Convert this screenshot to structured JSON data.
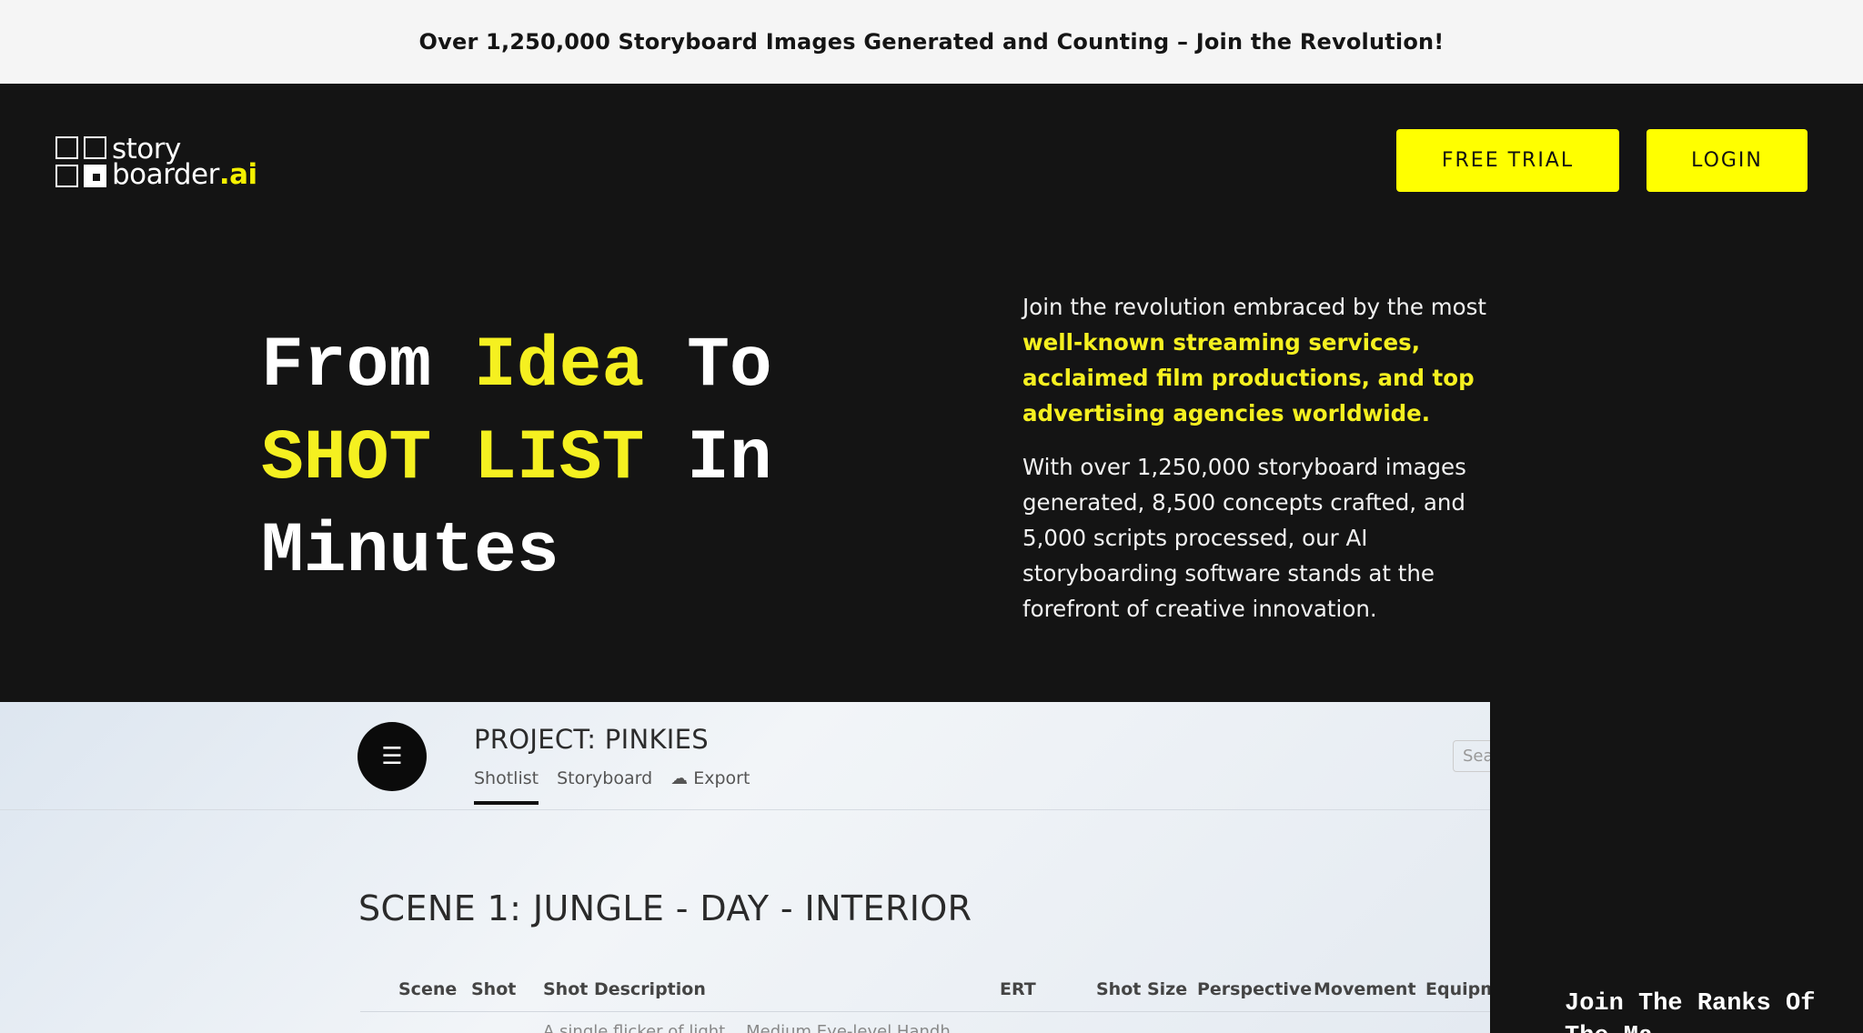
{
  "announcement": "Over 1,250,000 Storyboard Images Generated and Counting – Join the Revolution!",
  "logo": {
    "line1": "story",
    "line2_prefix": "boarder",
    "line2_suffix": ".ai"
  },
  "nav": {
    "free_trial": "FREE TRIAL",
    "login": "LOGIN"
  },
  "hero": {
    "title_1": "From ",
    "title_2": "Idea",
    "title_3": " To",
    "title_4": "SHOT LIST",
    "title_5": " In",
    "title_6": "Minutes",
    "copy_1_plain": "Join the revolution embraced by the most ",
    "copy_1_highlight": "well-known streaming services, acclaimed film productions, and top advertising agencies worldwide.",
    "copy_2": "With over 1,250,000 storyboard images generated, 8,500 concepts crafted, and 5,000 scripts processed, our AI storyboarding software stands at the forefront of creative innovation."
  },
  "screenshot": {
    "menu_icon": "list-icon",
    "project": "PROJECT: PINKIES",
    "tabs": [
      "Shotlist",
      "Storyboard",
      "Export"
    ],
    "search_placeholder": "Sea",
    "scene": "SCENE 1: JUNGLE - DAY - INTERIOR",
    "columns": [
      "Scene",
      "Shot",
      "Shot Description",
      "ERT",
      "Shot Size",
      "Perspective",
      "Movement",
      "Equipm"
    ],
    "row_text": "A single flicker of light... Medium  Eye-level  Handh"
  },
  "side_cta": "Join The Ranks Of The Ma"
}
